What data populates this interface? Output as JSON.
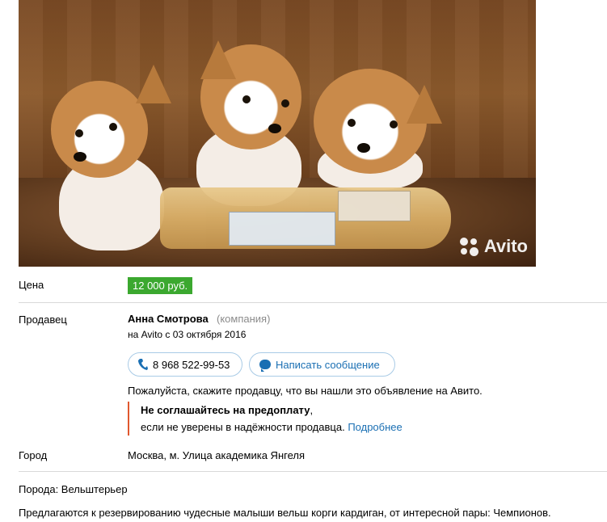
{
  "photo": {
    "watermark": "Avito",
    "icon": "avito-dots-logo"
  },
  "price": {
    "label": "Цена",
    "value": "12 000 руб."
  },
  "seller": {
    "label": "Продавец",
    "name": "Анна Смотрова",
    "type": "(компания)",
    "since": "на Avito с 03 октября 2016",
    "phone_button": "8 968 522-99-53",
    "message_button": "Написать сообщение",
    "please_text": "Пожалуйста, скажите продавцу, что вы нашли это объявление на Авито.",
    "warning_bold": "Не соглашайтесь на предоплату",
    "warning_comma": ",",
    "warning_text": "если не уверены в надёжности продавца.",
    "warning_link": "Подробнее"
  },
  "city": {
    "label": "Город",
    "value": "Москва, м. Улица академика Янгеля"
  },
  "breed": "Порода: Вельштерьер",
  "description": "Предлагаются к резервированию чудесные малыши вельш корги кардиган, от интересной пары: Чемпионов.",
  "colors": {
    "price_bg": "#3ba82f",
    "link": "#1a6fb3",
    "warning_border": "#e0582e",
    "button_border": "#a9cbe6"
  }
}
